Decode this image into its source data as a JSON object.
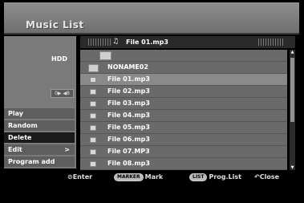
{
  "title": "Music List",
  "storage": {
    "label": "HDD",
    "indicator": "0▶ ◀8"
  },
  "current_file": {
    "icon": "music-note-icon",
    "name": "File 01.mp3"
  },
  "menu": [
    {
      "label": "Play"
    },
    {
      "label": "Random"
    },
    {
      "label": "Delete",
      "selected": true
    },
    {
      "label": "Edit",
      "arrow": ">"
    },
    {
      "label": "Program add"
    }
  ],
  "list": [
    {
      "label": "",
      "type": "parent-folder"
    },
    {
      "label": "NONAME02",
      "type": "folder"
    },
    {
      "label": "File 01.mp3",
      "type": "file",
      "highlighted": true
    },
    {
      "label": "File 02.mp3",
      "type": "file"
    },
    {
      "label": "File 03.mp3",
      "type": "file"
    },
    {
      "label": "File 04.mp3",
      "type": "file"
    },
    {
      "label": "File 05.mp3",
      "type": "file"
    },
    {
      "label": "File 06.mp3",
      "type": "file"
    },
    {
      "label": "File 07.MP3",
      "type": "file"
    },
    {
      "label": "File 08.mp3",
      "type": "file"
    }
  ],
  "footer": {
    "enter": "Enter",
    "marker_badge": "MARKER",
    "mark": "Mark",
    "list_badge": "LIST",
    "prog_list": "Prog.List",
    "close": "Close"
  },
  "colors": {
    "background": "#000000",
    "panel": "#6a6a6a",
    "highlight": "#8a8a8a",
    "selected_menu": "#1a1a1a"
  }
}
